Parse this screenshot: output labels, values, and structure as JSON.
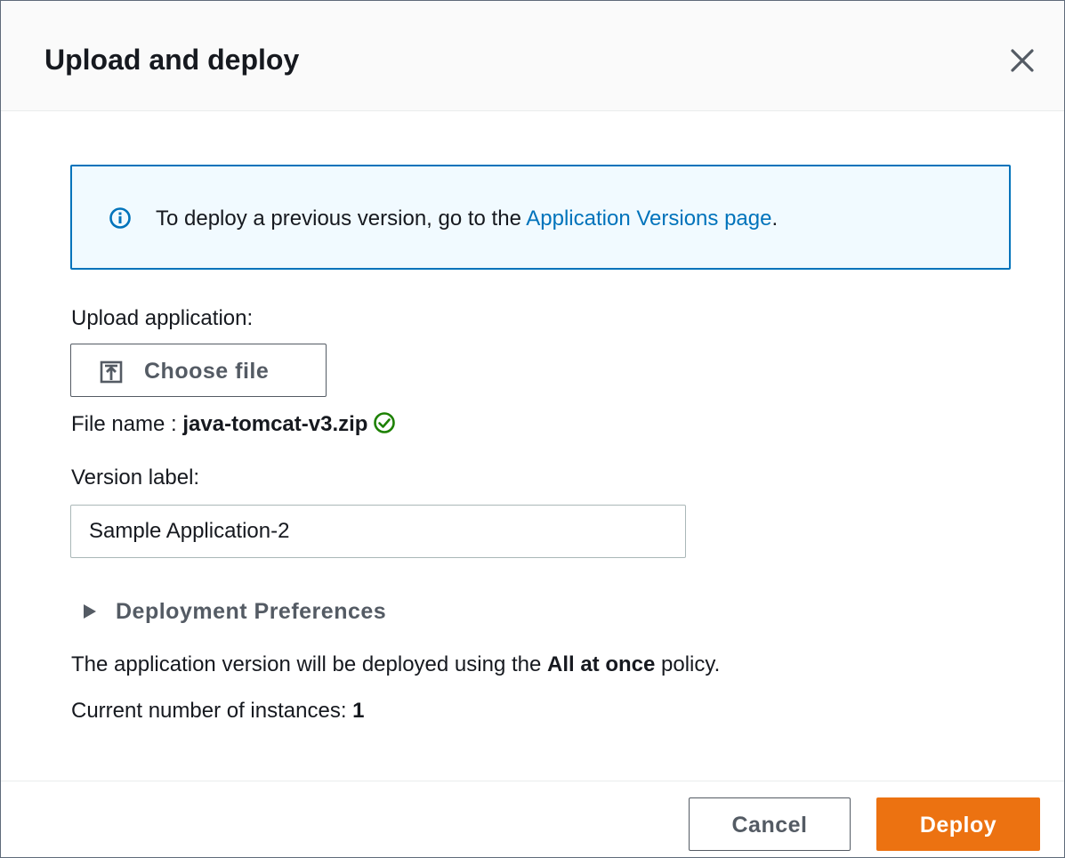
{
  "dialog": {
    "title": "Upload and deploy",
    "close_icon": "close-icon"
  },
  "info_alert": {
    "icon": "info-icon",
    "text_prefix": "To deploy a previous version, go to the ",
    "link_text": "Application Versions page",
    "text_suffix": "."
  },
  "upload": {
    "label": "Upload application:",
    "button_label": "Choose file",
    "button_icon": "upload-icon",
    "file_name_label": "File name : ",
    "file_name": "java-tomcat-v3.zip",
    "file_status_icon": "check-circle-icon"
  },
  "version": {
    "label": "Version label:",
    "value": "Sample Application-2"
  },
  "deployment_preferences": {
    "label": "Deployment Preferences",
    "expanded": false
  },
  "policy": {
    "text_prefix": "The application version will be deployed using the ",
    "policy_name": "All at once",
    "text_suffix": " policy."
  },
  "instances": {
    "label": "Current number of instances: ",
    "count": "1"
  },
  "footer": {
    "cancel_label": "Cancel",
    "deploy_label": "Deploy"
  },
  "colors": {
    "accent": "#0073bb",
    "primary_button": "#ec7211",
    "success": "#1d8102",
    "info_background": "#f1faff"
  }
}
